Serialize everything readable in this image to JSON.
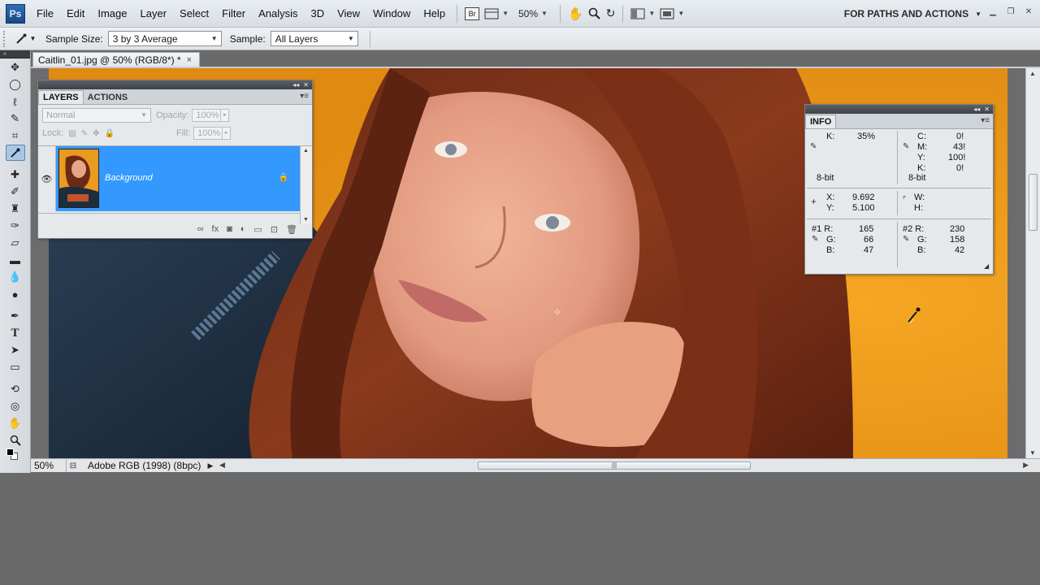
{
  "app": {
    "logo": "Ps",
    "menus": [
      "File",
      "Edit",
      "Image",
      "Layer",
      "Select",
      "Filter",
      "Analysis",
      "3D",
      "View",
      "Window",
      "Help"
    ],
    "zoom_dropdown": "50%",
    "workspace": "FOR PATHS AND ACTIONS"
  },
  "options_bar": {
    "sample_size_label": "Sample Size:",
    "sample_size_value": "3 by 3 Average",
    "sample_label": "Sample:",
    "sample_value": "All Layers"
  },
  "document": {
    "tab_title": "Caitlin_01.jpg @ 50% (RGB/8*) *",
    "close": "×"
  },
  "status_bar": {
    "zoom": "50%",
    "info": "Adobe RGB (1998) (8bpc)"
  },
  "layers_panel": {
    "tabs": [
      "LAYERS",
      "ACTIONS"
    ],
    "blend_mode": "Normal",
    "opacity_label": "Opacity:",
    "opacity_value": "100%",
    "lock_label": "Lock:",
    "fill_label": "Fill:",
    "fill_value": "100%",
    "layer_name": "Background"
  },
  "info_panel": {
    "tab": "INFO",
    "k_label": "K:",
    "k_value": "35%",
    "bit_left": "8-bit",
    "c_label": "C:",
    "c_value": "0!",
    "m_label": "M:",
    "m_value": "43!",
    "y_label": "Y:",
    "y_value": "100!",
    "k2_label": "K:",
    "k2_value": "0!",
    "bit_right": "8-bit",
    "x_label": "X:",
    "x_value": "9.692",
    "ypos_label": "Y:",
    "ypos_value": "5.100",
    "w_label": "W:",
    "h_label": "H:",
    "s1": {
      "title": "#1 R:",
      "r": "165",
      "g_label": "G:",
      "g": "66",
      "b_label": "B:",
      "b": "47"
    },
    "s2": {
      "title": "#2 R:",
      "r": "230",
      "g_label": "G:",
      "g": "158",
      "b_label": "B:",
      "b": "42"
    }
  },
  "colors": {
    "background_orange": "#e8951c",
    "layer_selected": "#3399ff",
    "ui_gray": "#6a6a6a"
  }
}
